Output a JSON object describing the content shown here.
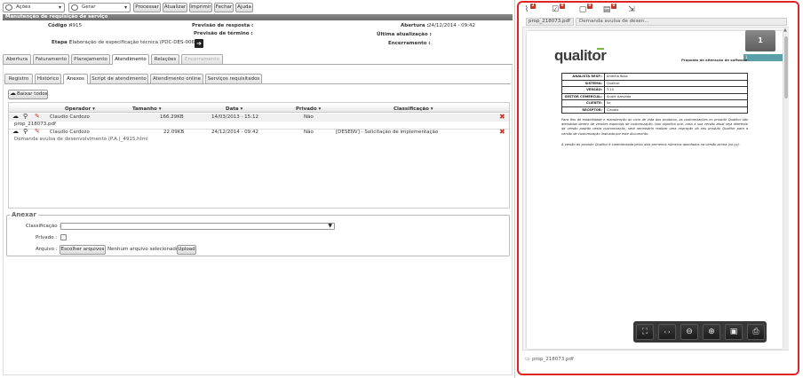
{
  "toolbar": {
    "actions_select": "Ações",
    "generate_select": "Gerar",
    "process_label": "Processar",
    "update_label": "Atualizar",
    "print_label": "Imprimir",
    "close_label": "Fechar",
    "help_label": "Ajuda"
  },
  "header": {
    "title": "Manutenção de requisição de serviço",
    "codigo_label": "Código :",
    "codigo_value": "4915",
    "etapa_label": "Etapa :",
    "etapa_value": "Elaboração de especificação técnica (PDC-DES-006)",
    "prev_resposta_label": "Previsão de resposta :",
    "prev_resposta_value": "-",
    "prev_termino_label": "Previsão de término :",
    "prev_termino_value": "-",
    "abertura_label": "Abertura :",
    "abertura_value": "24/12/2014 - 09:42",
    "ultima_label": "Última atualização :",
    "ultima_value": "-",
    "encerramento_label": "Encerramento :",
    "encerramento_value": "-"
  },
  "main_tabs": [
    "Abertura",
    "Faturamento",
    "Planejamento",
    "Atendimento",
    "Relações",
    "Encerramento"
  ],
  "sub_tabs": [
    "Registro",
    "Histórico",
    "Anexos",
    "Script de atendimento",
    "Atendimento online",
    "Serviços requisitados"
  ],
  "attachments": {
    "download_all": "Baixar todos",
    "columns": [
      "Operador ▾",
      "Tamanho ▾",
      "Data ▾",
      "Privado ▾",
      "Classificação ▾"
    ],
    "rows": [
      {
        "operator": "Claudio Cardozo",
        "size": "166.29KB",
        "date": "14/03/2013 - 15:12",
        "private": "Não",
        "classification": "",
        "filename": "prop_218073.pdf"
      },
      {
        "operator": "Claudio Cardozo",
        "size": "22.09KB",
        "date": "24/12/2014 - 09:42",
        "private": "Não",
        "classification": "[DESENV] - Solicitação de implementação",
        "filename": "Demanda avulsa de desenvolvimento (P.A.)_4915.html"
      }
    ]
  },
  "attach_form": {
    "legend": "Anexar",
    "class_label": "Classificação :",
    "private_label": "Privado :",
    "file_label": "Arquivo :",
    "choose_label": "Escolher arquivos",
    "no_file": "Nenhum arquivo selecionado",
    "upload_label": "Upload"
  },
  "viewer": {
    "badges": [
      "2",
      "0",
      "0",
      "0"
    ],
    "tabs": [
      "prop_218073.pdf",
      "Demanda avulsa de desen..."
    ],
    "page_number": "1",
    "page_label": "1",
    "footer_file": "prop_218073.pdf"
  },
  "pdf": {
    "logo": "qualitor",
    "heading": "Proposta de alteração de software",
    "table": [
      {
        "k": "ANALISTA RESP.:",
        "v": "Andréia Rosa"
      },
      {
        "k": "SISTEMA:",
        "v": "Qualitor"
      },
      {
        "k": "VERSÃO:",
        "v": "7.10"
      },
      {
        "k": "GESTOR COMERCIAL:",
        "v": "André Azevedo"
      },
      {
        "k": "CLIENTE:",
        "v": "5o"
      },
      {
        "k": "RECEPTOR:",
        "v": "Claudia"
      }
    ],
    "para1": "Para fins de estabilidade e manutenção do ciclo de vida dos produtos, as customizações no produto Qualitor são atendidas dentro de versões especiais de customização. Isso significa que, caso a sua versão atual seja diferente da versão padrão nesta customização, será necessário realizar uma migração do seu produto Qualitor para a versão de customização indicada por este documento.",
    "para2": "A versão do produto Qualitor é caracterizada pelos dois primeiros números apontados na versão acima (xx.yy)."
  }
}
